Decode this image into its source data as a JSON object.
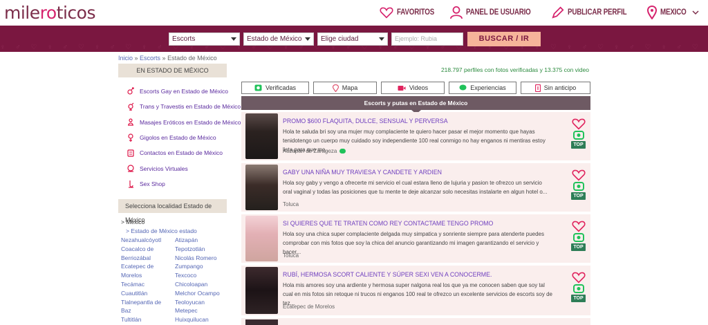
{
  "header": {
    "logo_part1": "mile",
    "logo_part2": "r",
    "logo_part3": "o",
    "logo_part4": "ticos",
    "nav": [
      {
        "label": "FAVORITOS",
        "icon": "heart-icon"
      },
      {
        "label": "PANEL DE USUARIO",
        "icon": "user-icon"
      },
      {
        "label": "PUBLICAR PERFIL",
        "icon": "pencil-icon"
      },
      {
        "label": "MEXICO",
        "icon": "location-pin-icon"
      }
    ]
  },
  "search": {
    "category": "Escorts",
    "state": "Estado de México",
    "city": "Elige ciudad",
    "placeholder": "Ejemplo: Rubia",
    "button": "BUSCAR / IR"
  },
  "breadcrumb": {
    "home": "Inicio",
    "sep1": " » ",
    "category": "Escorts",
    "sep2": " » ",
    "current": "Estado de México"
  },
  "sidebar": {
    "section_title": "EN ESTADO DE MÉXICO",
    "links": [
      {
        "label": "Escorts Gay en Estado de México",
        "icon": "gay-icon"
      },
      {
        "label": "Trans y Travestis en Estado de México",
        "icon": "trans-icon"
      },
      {
        "label": "Masajes Eróticos en Estado de México",
        "icon": "massage-icon"
      },
      {
        "label": "Gigolos en Estado de México",
        "icon": "gigolo-icon"
      },
      {
        "label": "Contactos en Estado de México",
        "icon": "contacts-icon"
      },
      {
        "label": "Servicios Virtuales",
        "icon": "virtual-icon"
      },
      {
        "label": "Sex Shop",
        "icon": "sexshop-icon"
      }
    ],
    "locality_title": "Selecciona localidad Estado de México",
    "loc_top": "> Mexico",
    "loc_sub": "> Estado de México estado",
    "localities": [
      "Nezahualcóyotl",
      "Atizapán",
      "Coacalco de",
      "Tepotzotlán",
      "Berriozábal",
      "Nicolás Romero",
      "Ecatepec de",
      "Zumpango",
      "Morelos",
      "Texcoco",
      "Tecámac",
      "Chicoloapan",
      "Cuautitlán",
      "Melchor Ocampo",
      "Tlalnepantla de",
      "Teoloyucan",
      "Baz",
      "Metepec",
      "Tultitlán",
      "Huixquilucan"
    ]
  },
  "main": {
    "stats": "218.797 perfiles con fotos verificadas y 13.375 con video",
    "filters": [
      {
        "label": "Verificadas",
        "icon": "camera-check-icon"
      },
      {
        "label": "Mapa",
        "icon": "map-pin-icon"
      },
      {
        "label": "Videos",
        "icon": "video-icon"
      },
      {
        "label": "Experiencias",
        "icon": "chat-icon"
      },
      {
        "label": "Sin anticipo",
        "icon": "money-icon"
      }
    ],
    "list_title": "Escorts y putas en Estado de México",
    "ads": [
      {
        "title": "PROMO $600 FLAQUITA, DULCE, SENSUAL Y PERVERSA",
        "desc": "Hola te saluda bri soy una mujer muy complaciente te quiero hacer pasar el mejor momento que hayas tenidotengo un cuerpo muy cuidado soy independiente 100 real conmigo no hay enganos ni mentiras estoy lista para que me...",
        "city": "Atizapán de Zaragoza",
        "badge": "TOP"
      },
      {
        "title": "GABY UNA NIÑA MUY TRAVIESA Y CANDETE Y ARDIEN",
        "desc": "Hola soy gaby y vengo a ofrecerte mi servicio el cual estara lleno de lujuria y pasion te ofrezco un servicio oral vaginal y todas las posiciones que tu mente te deje alcanzar solo necesitas instalarte en algun hotel o...",
        "city": "Toluca",
        "badge": "TOP"
      },
      {
        "title": "SI QUIERES QUE TE TRATEN COMO REY CONTACTAME TENGO PROMO",
        "desc": "Hola soy una chica super complaciente delgada muy simpatica y sonriente siempre para atenderte puedes comprobar con mis fotos que soy la chica del anuncio garantizando mi imagen garantizando el servicio y hacer...",
        "city": "Toluca",
        "badge": "TOP"
      },
      {
        "title": "RUBÍ, HERMOSA SCORT CALIENTE Y SÚPER SEXI VEN A CONOCERME.",
        "desc": "Hola mis amores soy una ardiente y hermosa super nalgona real los que ya me conocen saben que soy tal cual en mis fotos sin retoque ni trucos ni enganos 100 real te ofrezco un excelente servicios de escorts soy de tez...",
        "city": "Ecatepec de Morelos",
        "badge": "TOP"
      }
    ]
  }
}
